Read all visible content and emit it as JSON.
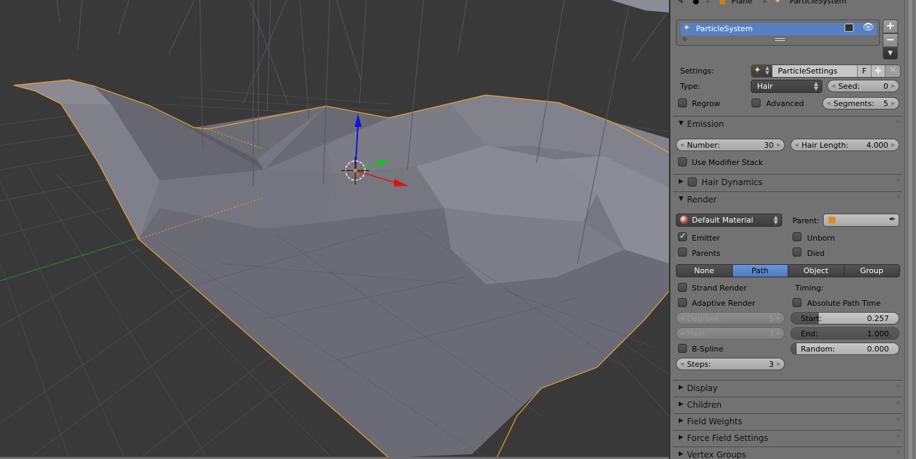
{
  "viewport": {
    "colors": {
      "background": "#393939",
      "selection_outline": "#f0a030",
      "mesh": "#7a7a88",
      "axis_x": "#e01010",
      "axis_y": "#20c020",
      "axis_z": "#1010e0"
    }
  },
  "properties": {
    "breadcrumb": [
      {
        "icon": "tool-icon",
        "label": ""
      },
      {
        "icon": "scene-icon",
        "label": ""
      },
      {
        "icon": "object-cube-icon",
        "label": "Plane"
      },
      {
        "icon": "particles-icon",
        "label": "ParticleSystem"
      }
    ],
    "particle_list": {
      "items": [
        {
          "label": "ParticleSystem",
          "selected": true
        }
      ],
      "add_label": "+",
      "remove_label": "−",
      "menu_label": "▼"
    },
    "settings": {
      "settings_label": "Settings:",
      "settings_value": "ParticleSettings",
      "fake_user_label": "F",
      "type_label": "Type:",
      "type_value": "Hair",
      "seed": {
        "label": "Seed:",
        "value": "0"
      },
      "regrow": {
        "label": "Regrow",
        "checked": false
      },
      "advanced": {
        "label": "Advanced",
        "checked": false
      },
      "segments": {
        "label": "Segments:",
        "value": "5"
      }
    },
    "panels": {
      "emission": {
        "title": "Emission",
        "expanded": true,
        "number": {
          "label": "Number:",
          "value": "30"
        },
        "hair_length": {
          "label": "Hair Length:",
          "value": "4.000"
        },
        "use_modifier_stack": {
          "label": "Use Modifier Stack",
          "checked": false
        }
      },
      "hair_dynamics": {
        "title": "Hair Dynamics",
        "expanded": false,
        "enabled": false
      },
      "render": {
        "title": "Render",
        "expanded": true,
        "material_value": "Default Material",
        "parent_label": "Parent:",
        "emitter": {
          "label": "Emitter",
          "checked": true
        },
        "unborn": {
          "label": "Unborn",
          "checked": false
        },
        "parents": {
          "label": "Parents",
          "checked": false
        },
        "died": {
          "label": "Died",
          "checked": false
        },
        "render_as": {
          "options": [
            "None",
            "Path",
            "Object",
            "Group"
          ],
          "selected": "Path"
        },
        "strand_render": {
          "label": "Strand Render",
          "checked": false
        },
        "timing_label": "Timing:",
        "adaptive_render": {
          "label": "Adaptive Render",
          "checked": false
        },
        "absolute_path_time": {
          "label": "Absolute Path Time",
          "checked": false
        },
        "degrees": {
          "label": "Degrees:",
          "value": "5",
          "disabled": true
        },
        "pixel": {
          "label": "Pixel:",
          "value": "3",
          "disabled": true
        },
        "start": {
          "label": "Start:",
          "value": "0.257",
          "fraction": 0.257
        },
        "end": {
          "label": "End:",
          "value": "1.000",
          "fraction": 1.0
        },
        "random": {
          "label": "Random:",
          "value": "0.000",
          "fraction": 0.0
        },
        "bspline": {
          "label": "B-Spline",
          "checked": false
        },
        "steps": {
          "label": "Steps:",
          "value": "3"
        }
      },
      "collapsed": [
        {
          "title": "Display"
        },
        {
          "title": "Children"
        },
        {
          "title": "Field Weights"
        },
        {
          "title": "Force Field Settings"
        },
        {
          "title": "Vertex Groups"
        }
      ]
    },
    "colors": {
      "panel_bg": "#727272",
      "selected_row": "#5680c2",
      "active_toggle": "#5a87cc"
    }
  }
}
